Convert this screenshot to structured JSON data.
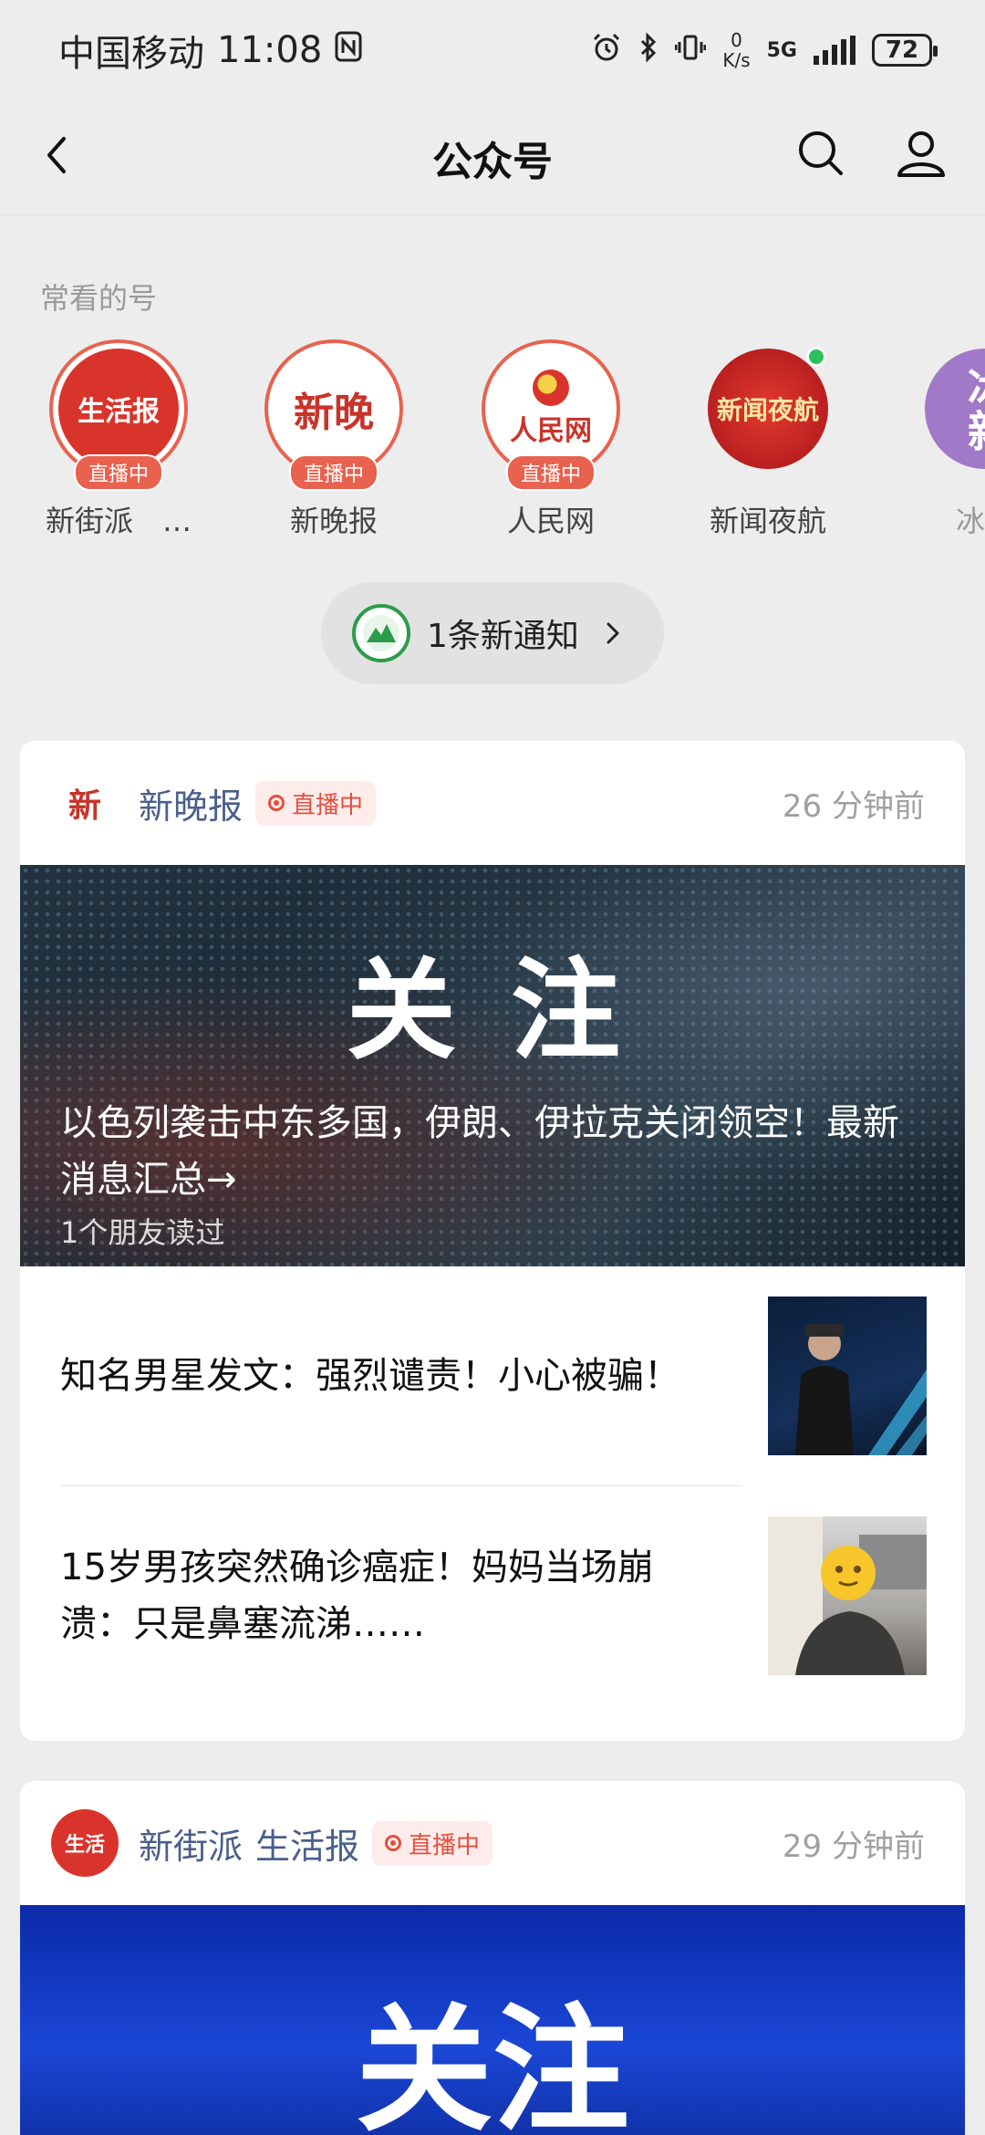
{
  "status_bar": {
    "carrier": "中国移动",
    "time": "11:08",
    "net_speed_value": "0",
    "net_speed_unit": "K/s",
    "network": "5G",
    "battery": "72"
  },
  "nav": {
    "title": "公众号"
  },
  "frequent": {
    "label": "常看的号",
    "items": [
      {
        "name": "新街派　…",
        "logo_text": "生活报",
        "live": "直播中",
        "color": "#d9342b"
      },
      {
        "name": "新晚报",
        "logo_text": "新晚",
        "live": "直播中",
        "color": "#c8342a"
      },
      {
        "name": "人民网",
        "logo_text": "人民网",
        "live": "直播中",
        "color": "#d9342b"
      },
      {
        "name": "新闻夜航",
        "logo_text": "新闻夜航",
        "live": "",
        "color": "#c71f1f"
      },
      {
        "name": "冰城",
        "logo_text": "冰新",
        "live": "",
        "color": "#a07ac8"
      }
    ]
  },
  "notification": {
    "text": "1条新通知"
  },
  "cards": [
    {
      "account": "新晚报",
      "live": "直播中",
      "time": "26 分钟前",
      "hero": {
        "big_text": "关注",
        "title": "以色列袭击中东多国，伊朗、伊拉克关闭领空！最新消息汇总→",
        "sub": "1个朋友读过"
      },
      "articles": [
        {
          "title": "知名男星发文：强烈谴责！小心被骗！"
        },
        {
          "title": "15岁男孩突然确诊癌症！妈妈当场崩溃：只是鼻塞流涕……"
        }
      ]
    },
    {
      "account": "新街派",
      "account2": "生活报",
      "live": "直播中",
      "time": "29 分钟前",
      "hero": {
        "big_text": "关注"
      }
    }
  ],
  "colors": {
    "live_red": "#e8624f",
    "link_blue": "#4a5f8a",
    "background": "#ededed"
  }
}
